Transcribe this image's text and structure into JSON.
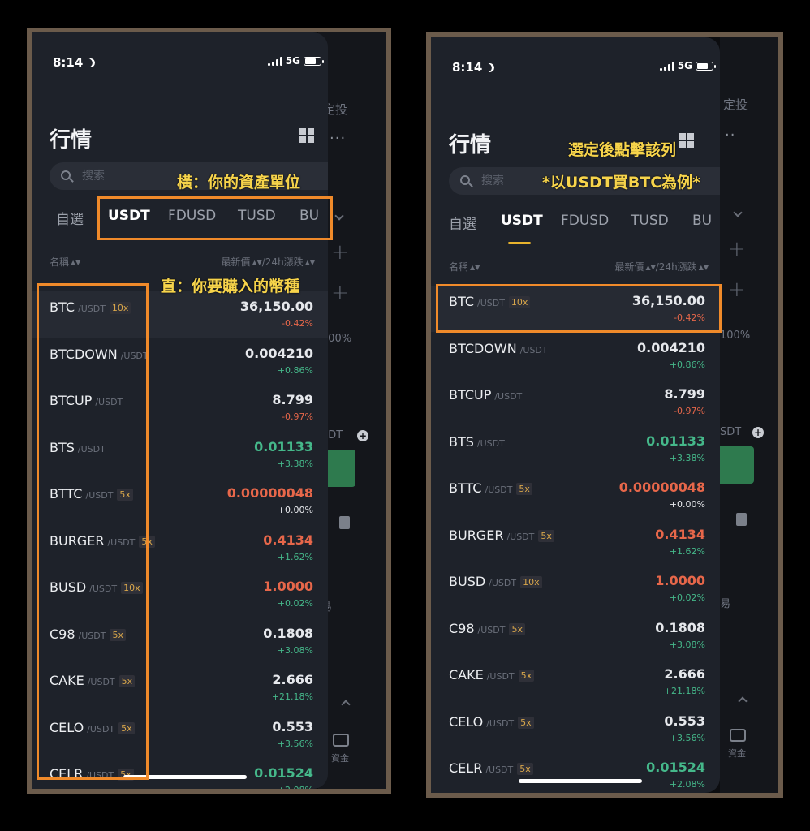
{
  "status": {
    "time": "8:14",
    "network": "5G"
  },
  "header": {
    "title": "行情"
  },
  "search": {
    "placeholder": "搜索"
  },
  "tabs": [
    "自選",
    "USDT",
    "FDUSD",
    "TUSD",
    "BU"
  ],
  "columns": {
    "name": "名稱",
    "price": "最新價",
    "sep": "/",
    "change": "24h漲跌"
  },
  "quote_unit": "/USDT",
  "rows": [
    {
      "symbol": "BTC",
      "leverage": "10x",
      "price": "36,150.00",
      "change": "-0.42%",
      "price_dir": "flat",
      "change_dir": "down"
    },
    {
      "symbol": "BTCDOWN",
      "leverage": "",
      "price": "0.004210",
      "change": "+0.86%",
      "price_dir": "flat",
      "change_dir": "up"
    },
    {
      "symbol": "BTCUP",
      "leverage": "",
      "price": "8.799",
      "change": "-0.97%",
      "price_dir": "flat",
      "change_dir": "down"
    },
    {
      "symbol": "BTS",
      "leverage": "",
      "price": "0.01133",
      "change": "+3.38%",
      "price_dir": "up",
      "change_dir": "up"
    },
    {
      "symbol": "BTTC",
      "leverage": "5x",
      "price": "0.00000048",
      "change": "+0.00%",
      "price_dir": "down",
      "change_dir": "flat"
    },
    {
      "symbol": "BURGER",
      "leverage": "5x",
      "price": "0.4134",
      "change": "+1.62%",
      "price_dir": "down",
      "change_dir": "up"
    },
    {
      "symbol": "BUSD",
      "leverage": "10x",
      "price": "1.0000",
      "change": "+0.02%",
      "price_dir": "down",
      "change_dir": "up"
    },
    {
      "symbol": "C98",
      "leverage": "5x",
      "price": "0.1808",
      "change": "+3.08%",
      "price_dir": "flat",
      "change_dir": "up"
    },
    {
      "symbol": "CAKE",
      "leverage": "5x",
      "price": "2.666",
      "change": "+21.18%",
      "price_dir": "flat",
      "change_dir": "up"
    },
    {
      "symbol": "CELO",
      "leverage": "5x",
      "price": "0.553",
      "change": "+3.56%",
      "price_dir": "flat",
      "change_dir": "up"
    },
    {
      "symbol": "CELR",
      "leverage": "5x",
      "price": "0.01524",
      "change": "+2.08%",
      "price_dir": "up",
      "change_dir": "up"
    }
  ],
  "background_page": {
    "dca": "定投",
    "asset_unit": "SDT",
    "percent": "100%",
    "trade": "易",
    "funds": "資金"
  },
  "annotations": {
    "left_horizontal": "橫：你的資產單位",
    "left_vertical": "直：你要購入的幣種",
    "right_line1": "選定後點擊該列",
    "right_line2": "*以USDT買BTC為例*"
  },
  "colors": {
    "accent": "#e8b32d",
    "highlight_box": "#f08a2a",
    "up": "#45b88a",
    "down": "#e7674a",
    "annotation": "#f7d44b"
  }
}
